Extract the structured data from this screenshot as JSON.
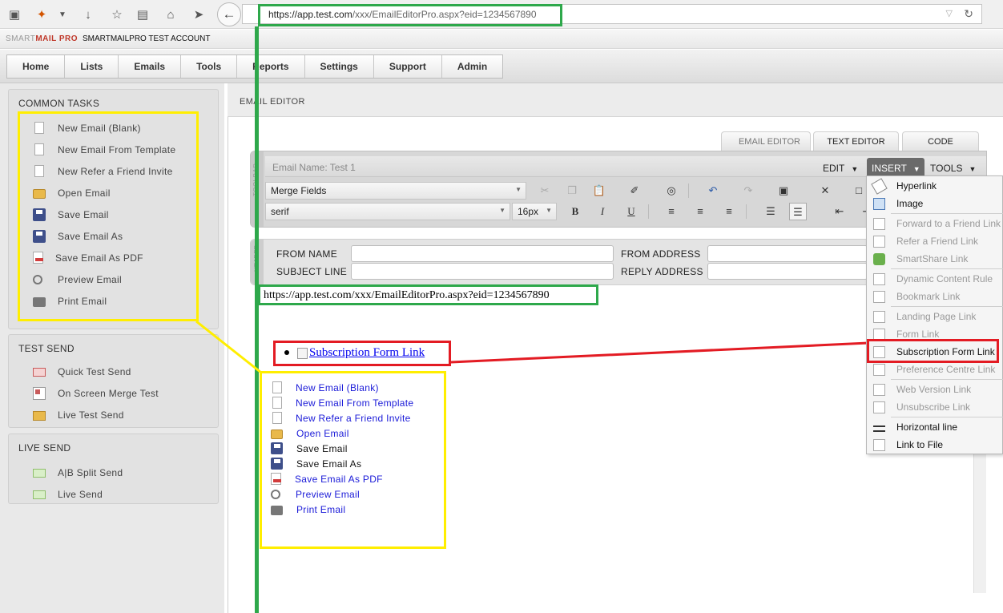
{
  "browser": {
    "url_host": "https://app.test.com",
    "url_path": "/xxx/EmailEditorPro.aspx?eid=1234567890"
  },
  "app": {
    "brand_prefix": "SMART",
    "brand_suffix": "MAIL PRO",
    "account_name": "SMARTMAILPRO TEST ACCOUNT"
  },
  "nav": {
    "items": [
      "Home",
      "Lists",
      "Emails",
      "Tools",
      "Reports",
      "Settings",
      "Support",
      "Admin"
    ]
  },
  "sidebar": {
    "common_tasks": {
      "title": "COMMON TASKS",
      "items": [
        {
          "label": "New Email (Blank)",
          "icon": "document-icon"
        },
        {
          "label": "New Email From Template",
          "icon": "document-icon"
        },
        {
          "label": "New Refer a Friend Invite",
          "icon": "document-icon"
        },
        {
          "label": "Open Email",
          "icon": "folder-open-icon"
        },
        {
          "label": "Save Email",
          "icon": "floppy-icon"
        },
        {
          "label": "Save Email As",
          "icon": "floppy-icon"
        },
        {
          "label": "Save Email As PDF",
          "icon": "pdf-icon"
        },
        {
          "label": "Preview Email",
          "icon": "magnifier-icon"
        },
        {
          "label": "Print Email",
          "icon": "printer-icon"
        }
      ]
    },
    "test_send": {
      "title": "TEST SEND",
      "items": [
        {
          "label": "Quick Test Send",
          "icon": "mail-icon"
        },
        {
          "label": "On Screen Merge Test",
          "icon": "merge-icon"
        },
        {
          "label": "Live Test Send",
          "icon": "folder-mail-icon"
        }
      ]
    },
    "live_send": {
      "title": "LIVE SEND",
      "items": [
        {
          "label": "A|B Split Send",
          "icon": "split-icon"
        },
        {
          "label": "Live Send",
          "icon": "send-mail-icon"
        }
      ]
    }
  },
  "content": {
    "title": "EMAIL EDITOR",
    "tabs": [
      "EMAIL EDITOR",
      "TEXT EDITOR",
      "CODE EDITOR"
    ],
    "email_name": "Email Name: Test 1",
    "menus": {
      "edit": "EDIT",
      "insert": "INSERT",
      "tools": "TOOLS"
    },
    "merge_fields": "Merge Fields",
    "font_family": "serif",
    "font_size": "16px",
    "toolbar_side_label": "TOOLBAR",
    "header_side_label": "HEADER",
    "fields": {
      "from_name": "FROM NAME",
      "from_address": "FROM ADDRESS",
      "subject_line": "SUBJECT LINE",
      "reply_address": "REPLY ADDRESS"
    }
  },
  "editor_body": {
    "url_text": "https://app.test.com/xxx/EmailEditorPro.aspx?eid=1234567890",
    "bullet_link": "Subscription Form Link",
    "pasted_items": [
      {
        "label": "New Email (Blank)",
        "link": true
      },
      {
        "label": "New Email From Template",
        "link": true
      },
      {
        "label": "New Refer a Friend Invite",
        "link": true
      },
      {
        "label": "Open Email",
        "link": true
      },
      {
        "label": "Save Email",
        "link": false
      },
      {
        "label": "Save Email As",
        "link": false
      },
      {
        "label": "Save Email As PDF",
        "link": true
      },
      {
        "label": "Preview Email",
        "link": true
      },
      {
        "label": "Print Email",
        "link": true
      }
    ]
  },
  "insert_menu": {
    "items": [
      {
        "label": "Hyperlink",
        "enabled": true
      },
      {
        "label": "Image",
        "enabled": true
      },
      {
        "label": "Forward to a Friend Link",
        "enabled": false
      },
      {
        "label": "Refer a Friend Link",
        "enabled": false
      },
      {
        "label": "SmartShare Link",
        "enabled": false
      },
      {
        "label": "Dynamic Content Rule",
        "enabled": false
      },
      {
        "label": "Bookmark Link",
        "enabled": false
      },
      {
        "label": "Landing Page Link",
        "enabled": false
      },
      {
        "label": "Form Link",
        "enabled": false
      },
      {
        "label": "Subscription Form Link",
        "enabled": true
      },
      {
        "label": "Preference Centre Link",
        "enabled": false
      },
      {
        "label": "Web Version Link",
        "enabled": false
      },
      {
        "label": "Unsubscribe Link",
        "enabled": false
      },
      {
        "label": "Horizontal line",
        "enabled": true
      },
      {
        "label": "Link to File",
        "enabled": true
      }
    ]
  },
  "colors": {
    "annotation_yellow": "#ffee00",
    "annotation_green": "#2ea84b",
    "annotation_red": "#e31b23",
    "link_blue": "#1a1ad8",
    "brand_red": "#c0392b"
  }
}
